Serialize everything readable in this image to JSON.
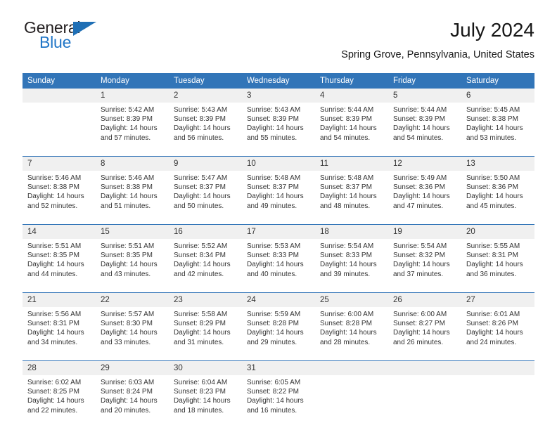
{
  "logo": {
    "word_top": "General",
    "word_bottom": "Blue",
    "triangle_color": "#1f6fb5",
    "blue_color": "#2176c7"
  },
  "header": {
    "title": "July 2024",
    "location": "Spring Grove, Pennsylvania, United States"
  },
  "theme": {
    "header_blue": "#3275b8",
    "daynum_band": "#f0f0f0",
    "text": "#333333"
  },
  "calendar": {
    "weekday_headers": [
      "Sunday",
      "Monday",
      "Tuesday",
      "Wednesday",
      "Thursday",
      "Friday",
      "Saturday"
    ],
    "weeks": [
      [
        {
          "day": "",
          "sunrise": "",
          "sunset": "",
          "daylight1": "",
          "daylight2": ""
        },
        {
          "day": "1",
          "sunrise": "Sunrise: 5:42 AM",
          "sunset": "Sunset: 8:39 PM",
          "daylight1": "Daylight: 14 hours",
          "daylight2": "and 57 minutes."
        },
        {
          "day": "2",
          "sunrise": "Sunrise: 5:43 AM",
          "sunset": "Sunset: 8:39 PM",
          "daylight1": "Daylight: 14 hours",
          "daylight2": "and 56 minutes."
        },
        {
          "day": "3",
          "sunrise": "Sunrise: 5:43 AM",
          "sunset": "Sunset: 8:39 PM",
          "daylight1": "Daylight: 14 hours",
          "daylight2": "and 55 minutes."
        },
        {
          "day": "4",
          "sunrise": "Sunrise: 5:44 AM",
          "sunset": "Sunset: 8:39 PM",
          "daylight1": "Daylight: 14 hours",
          "daylight2": "and 54 minutes."
        },
        {
          "day": "5",
          "sunrise": "Sunrise: 5:44 AM",
          "sunset": "Sunset: 8:39 PM",
          "daylight1": "Daylight: 14 hours",
          "daylight2": "and 54 minutes."
        },
        {
          "day": "6",
          "sunrise": "Sunrise: 5:45 AM",
          "sunset": "Sunset: 8:38 PM",
          "daylight1": "Daylight: 14 hours",
          "daylight2": "and 53 minutes."
        }
      ],
      [
        {
          "day": "7",
          "sunrise": "Sunrise: 5:46 AM",
          "sunset": "Sunset: 8:38 PM",
          "daylight1": "Daylight: 14 hours",
          "daylight2": "and 52 minutes."
        },
        {
          "day": "8",
          "sunrise": "Sunrise: 5:46 AM",
          "sunset": "Sunset: 8:38 PM",
          "daylight1": "Daylight: 14 hours",
          "daylight2": "and 51 minutes."
        },
        {
          "day": "9",
          "sunrise": "Sunrise: 5:47 AM",
          "sunset": "Sunset: 8:37 PM",
          "daylight1": "Daylight: 14 hours",
          "daylight2": "and 50 minutes."
        },
        {
          "day": "10",
          "sunrise": "Sunrise: 5:48 AM",
          "sunset": "Sunset: 8:37 PM",
          "daylight1": "Daylight: 14 hours",
          "daylight2": "and 49 minutes."
        },
        {
          "day": "11",
          "sunrise": "Sunrise: 5:48 AM",
          "sunset": "Sunset: 8:37 PM",
          "daylight1": "Daylight: 14 hours",
          "daylight2": "and 48 minutes."
        },
        {
          "day": "12",
          "sunrise": "Sunrise: 5:49 AM",
          "sunset": "Sunset: 8:36 PM",
          "daylight1": "Daylight: 14 hours",
          "daylight2": "and 47 minutes."
        },
        {
          "day": "13",
          "sunrise": "Sunrise: 5:50 AM",
          "sunset": "Sunset: 8:36 PM",
          "daylight1": "Daylight: 14 hours",
          "daylight2": "and 45 minutes."
        }
      ],
      [
        {
          "day": "14",
          "sunrise": "Sunrise: 5:51 AM",
          "sunset": "Sunset: 8:35 PM",
          "daylight1": "Daylight: 14 hours",
          "daylight2": "and 44 minutes."
        },
        {
          "day": "15",
          "sunrise": "Sunrise: 5:51 AM",
          "sunset": "Sunset: 8:35 PM",
          "daylight1": "Daylight: 14 hours",
          "daylight2": "and 43 minutes."
        },
        {
          "day": "16",
          "sunrise": "Sunrise: 5:52 AM",
          "sunset": "Sunset: 8:34 PM",
          "daylight1": "Daylight: 14 hours",
          "daylight2": "and 42 minutes."
        },
        {
          "day": "17",
          "sunrise": "Sunrise: 5:53 AM",
          "sunset": "Sunset: 8:33 PM",
          "daylight1": "Daylight: 14 hours",
          "daylight2": "and 40 minutes."
        },
        {
          "day": "18",
          "sunrise": "Sunrise: 5:54 AM",
          "sunset": "Sunset: 8:33 PM",
          "daylight1": "Daylight: 14 hours",
          "daylight2": "and 39 minutes."
        },
        {
          "day": "19",
          "sunrise": "Sunrise: 5:54 AM",
          "sunset": "Sunset: 8:32 PM",
          "daylight1": "Daylight: 14 hours",
          "daylight2": "and 37 minutes."
        },
        {
          "day": "20",
          "sunrise": "Sunrise: 5:55 AM",
          "sunset": "Sunset: 8:31 PM",
          "daylight1": "Daylight: 14 hours",
          "daylight2": "and 36 minutes."
        }
      ],
      [
        {
          "day": "21",
          "sunrise": "Sunrise: 5:56 AM",
          "sunset": "Sunset: 8:31 PM",
          "daylight1": "Daylight: 14 hours",
          "daylight2": "and 34 minutes."
        },
        {
          "day": "22",
          "sunrise": "Sunrise: 5:57 AM",
          "sunset": "Sunset: 8:30 PM",
          "daylight1": "Daylight: 14 hours",
          "daylight2": "and 33 minutes."
        },
        {
          "day": "23",
          "sunrise": "Sunrise: 5:58 AM",
          "sunset": "Sunset: 8:29 PM",
          "daylight1": "Daylight: 14 hours",
          "daylight2": "and 31 minutes."
        },
        {
          "day": "24",
          "sunrise": "Sunrise: 5:59 AM",
          "sunset": "Sunset: 8:28 PM",
          "daylight1": "Daylight: 14 hours",
          "daylight2": "and 29 minutes."
        },
        {
          "day": "25",
          "sunrise": "Sunrise: 6:00 AM",
          "sunset": "Sunset: 8:28 PM",
          "daylight1": "Daylight: 14 hours",
          "daylight2": "and 28 minutes."
        },
        {
          "day": "26",
          "sunrise": "Sunrise: 6:00 AM",
          "sunset": "Sunset: 8:27 PM",
          "daylight1": "Daylight: 14 hours",
          "daylight2": "and 26 minutes."
        },
        {
          "day": "27",
          "sunrise": "Sunrise: 6:01 AM",
          "sunset": "Sunset: 8:26 PM",
          "daylight1": "Daylight: 14 hours",
          "daylight2": "and 24 minutes."
        }
      ],
      [
        {
          "day": "28",
          "sunrise": "Sunrise: 6:02 AM",
          "sunset": "Sunset: 8:25 PM",
          "daylight1": "Daylight: 14 hours",
          "daylight2": "and 22 minutes."
        },
        {
          "day": "29",
          "sunrise": "Sunrise: 6:03 AM",
          "sunset": "Sunset: 8:24 PM",
          "daylight1": "Daylight: 14 hours",
          "daylight2": "and 20 minutes."
        },
        {
          "day": "30",
          "sunrise": "Sunrise: 6:04 AM",
          "sunset": "Sunset: 8:23 PM",
          "daylight1": "Daylight: 14 hours",
          "daylight2": "and 18 minutes."
        },
        {
          "day": "31",
          "sunrise": "Sunrise: 6:05 AM",
          "sunset": "Sunset: 8:22 PM",
          "daylight1": "Daylight: 14 hours",
          "daylight2": "and 16 minutes."
        },
        {
          "day": "",
          "sunrise": "",
          "sunset": "",
          "daylight1": "",
          "daylight2": ""
        },
        {
          "day": "",
          "sunrise": "",
          "sunset": "",
          "daylight1": "",
          "daylight2": ""
        },
        {
          "day": "",
          "sunrise": "",
          "sunset": "",
          "daylight1": "",
          "daylight2": ""
        }
      ]
    ]
  }
}
